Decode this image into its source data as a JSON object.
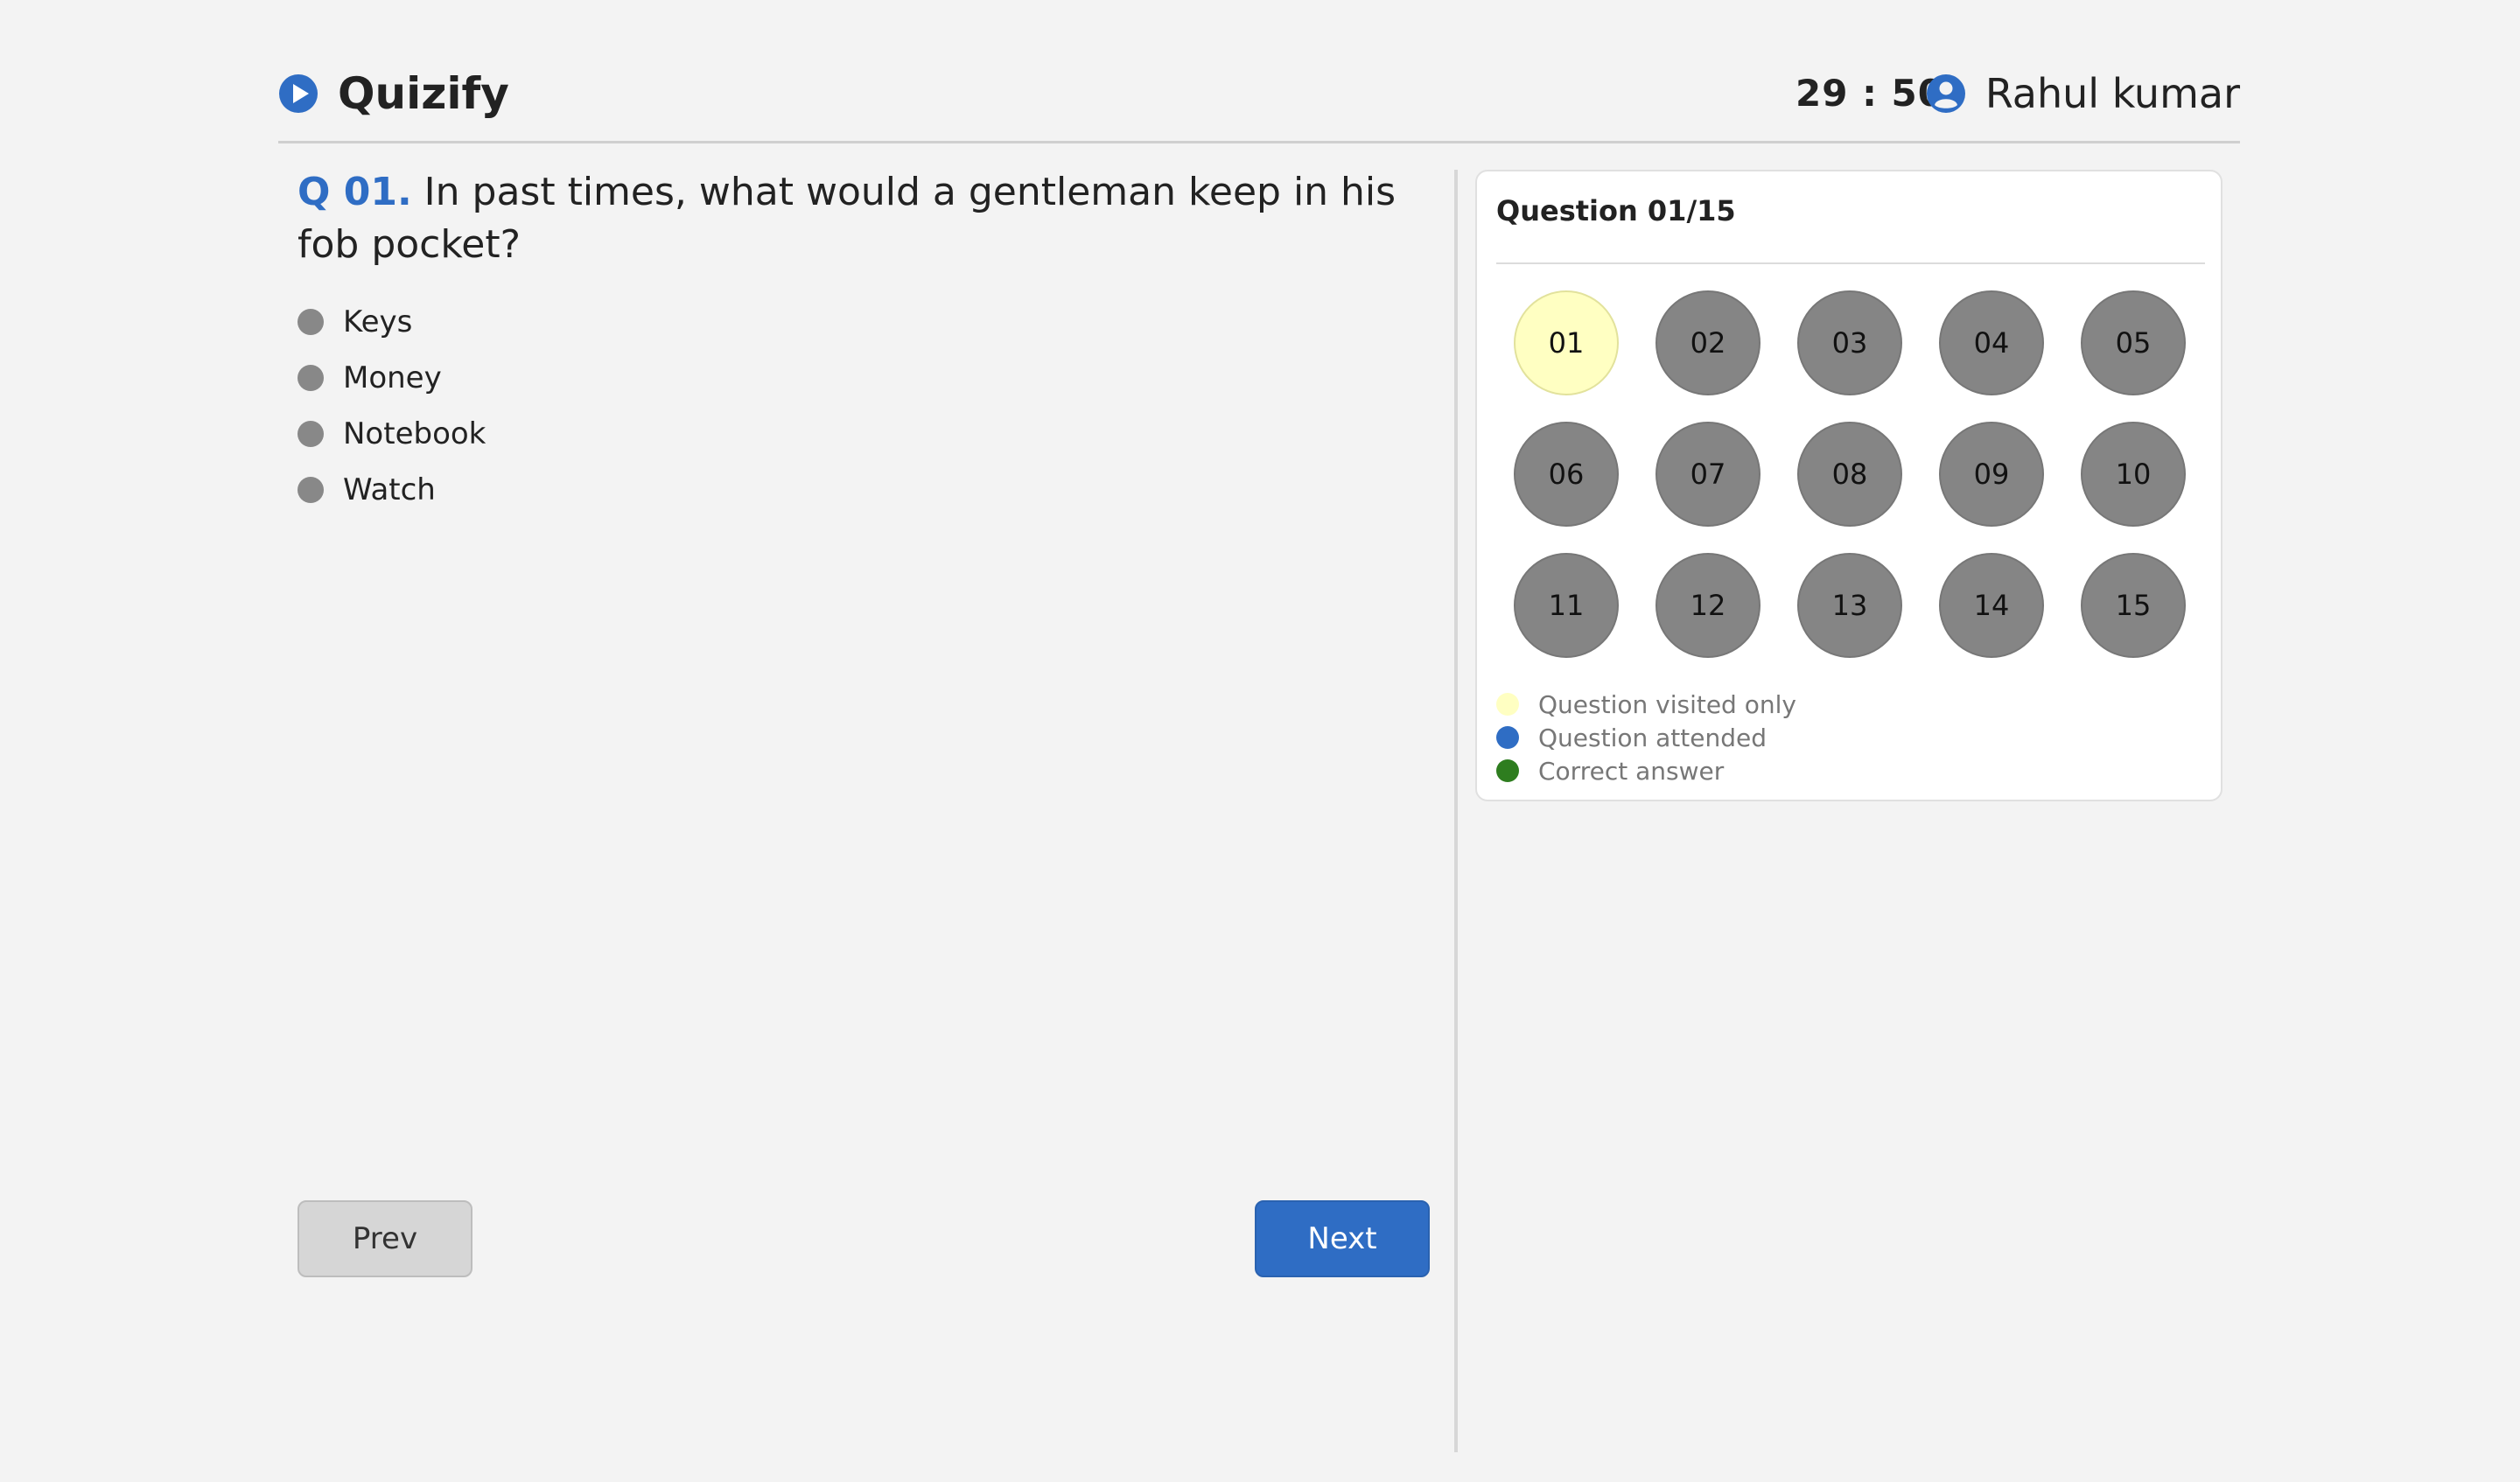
{
  "header": {
    "brand_name": "Quizify",
    "timer": "29 : 50",
    "user_name": "Rahul kumar"
  },
  "question": {
    "number": "Q 01.",
    "text": "In past times, what would a gentleman keep in his fob pocket?",
    "options": [
      "Keys",
      "Money",
      "Notebook",
      "Watch"
    ]
  },
  "nav": {
    "prev_label": "Prev",
    "next_label": "Next"
  },
  "palette": {
    "title": "Question 01/15",
    "questions": [
      "01",
      "02",
      "03",
      "04",
      "05",
      "06",
      "07",
      "08",
      "09",
      "10",
      "11",
      "12",
      "13",
      "14",
      "15"
    ],
    "visited_index": 0,
    "legend": [
      {
        "label": "Question visited only",
        "color": "#ffffc2"
      },
      {
        "label": "Question attended",
        "color": "#2f6dc4"
      },
      {
        "label": "Correct answer",
        "color": "#2e7d1f"
      }
    ]
  },
  "colors": {
    "accent": "#2f6dc4",
    "unvisited": "#858585",
    "visited": "#ffffc2"
  }
}
